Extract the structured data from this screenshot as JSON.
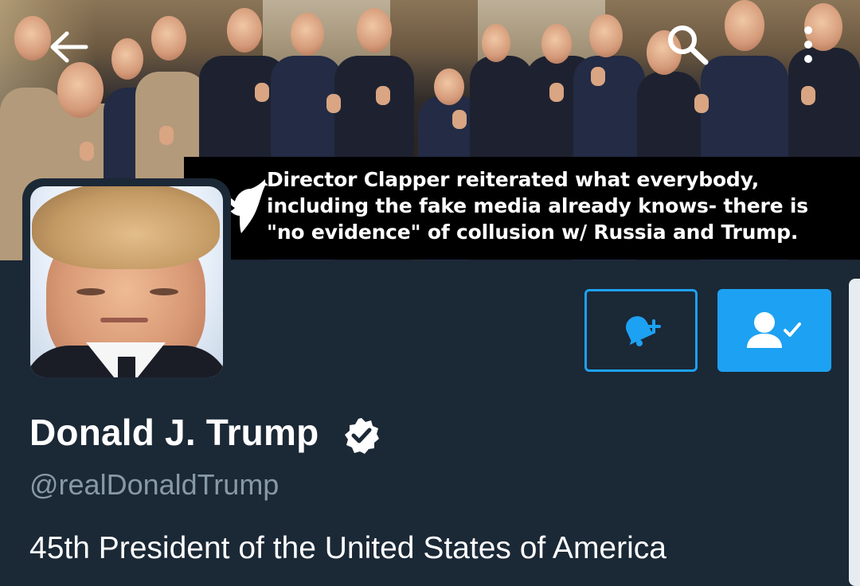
{
  "header": {
    "back_icon": "back-arrow-icon",
    "search_icon": "search-icon",
    "more_icon": "more-vertical-icon"
  },
  "banner_quote": {
    "lines": [
      "Director Clapper reiterated what everybody,",
      "including the fake media already knows- there is",
      "\"no evidence\" of collusion w/ Russia and Trump."
    ],
    "icon": "twitter-bird-icon"
  },
  "actions": {
    "notify_icon": "bell-plus-icon",
    "following_icon": "user-check-icon",
    "accent_color": "#1da1f2"
  },
  "profile": {
    "name": "Donald J. Trump",
    "verified_icon": "verified-badge-icon",
    "handle": "@realDonaldTrump",
    "bio": "45th President of the United States of America"
  },
  "colors": {
    "background": "#1b2836",
    "handle_text": "#8899a6"
  }
}
